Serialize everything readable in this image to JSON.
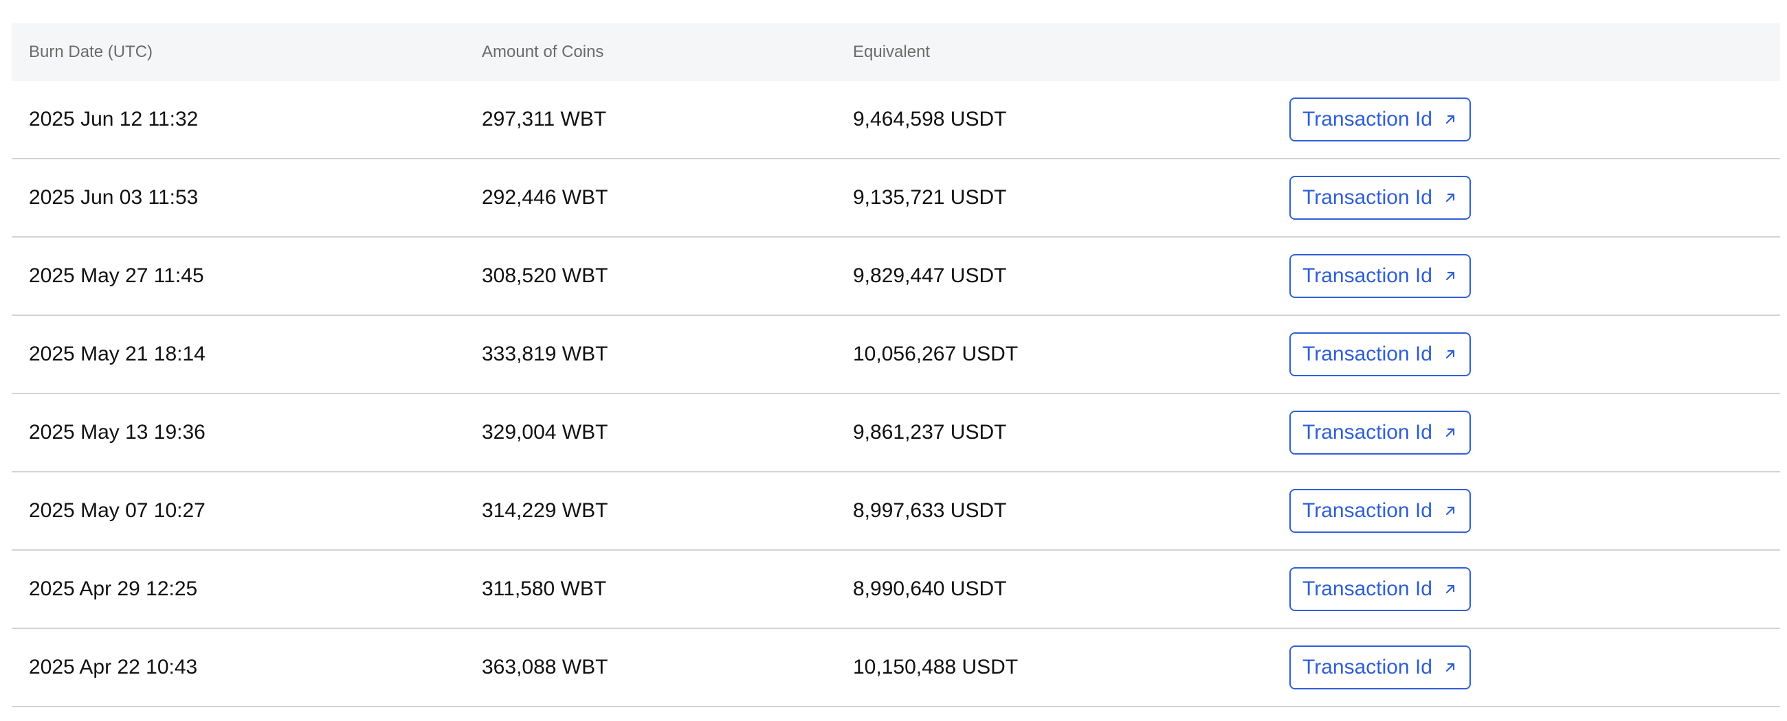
{
  "table": {
    "headers": {
      "date": "Burn Date (UTC)",
      "amount": "Amount of Coins",
      "equivalent": "Equivalent",
      "transaction": ""
    },
    "rows": [
      {
        "date": "2025 Jun 12 11:32",
        "amount": "297,311 WBT",
        "equivalent": "9,464,598 USDT",
        "tx_label": "Transaction Id"
      },
      {
        "date": "2025 Jun 03 11:53",
        "amount": "292,446 WBT",
        "equivalent": "9,135,721 USDT",
        "tx_label": "Transaction Id"
      },
      {
        "date": "2025 May 27 11:45",
        "amount": "308,520 WBT",
        "equivalent": "9,829,447 USDT",
        "tx_label": "Transaction Id"
      },
      {
        "date": "2025 May 21 18:14",
        "amount": "333,819 WBT",
        "equivalent": "10,056,267 USDT",
        "tx_label": "Transaction Id"
      },
      {
        "date": "2025 May 13 19:36",
        "amount": "329,004 WBT",
        "equivalent": "9,861,237 USDT",
        "tx_label": "Transaction Id"
      },
      {
        "date": "2025 May 07 10:27",
        "amount": "314,229 WBT",
        "equivalent": "8,997,633 USDT",
        "tx_label": "Transaction Id"
      },
      {
        "date": "2025 Apr 29 12:25",
        "amount": "311,580 WBT",
        "equivalent": "8,990,640 USDT",
        "tx_label": "Transaction Id"
      },
      {
        "date": "2025 Apr 22 10:43",
        "amount": "363,088 WBT",
        "equivalent": "10,150,488 USDT",
        "tx_label": "Transaction Id"
      }
    ]
  },
  "icons": {
    "external_link": "arrow-up-right-icon"
  },
  "colors": {
    "accent": "#2f5fd6",
    "header_bg": "#f5f6f7",
    "header_text": "#6b6b6b",
    "row_divider": "#d4d4d4",
    "text": "#111111"
  }
}
